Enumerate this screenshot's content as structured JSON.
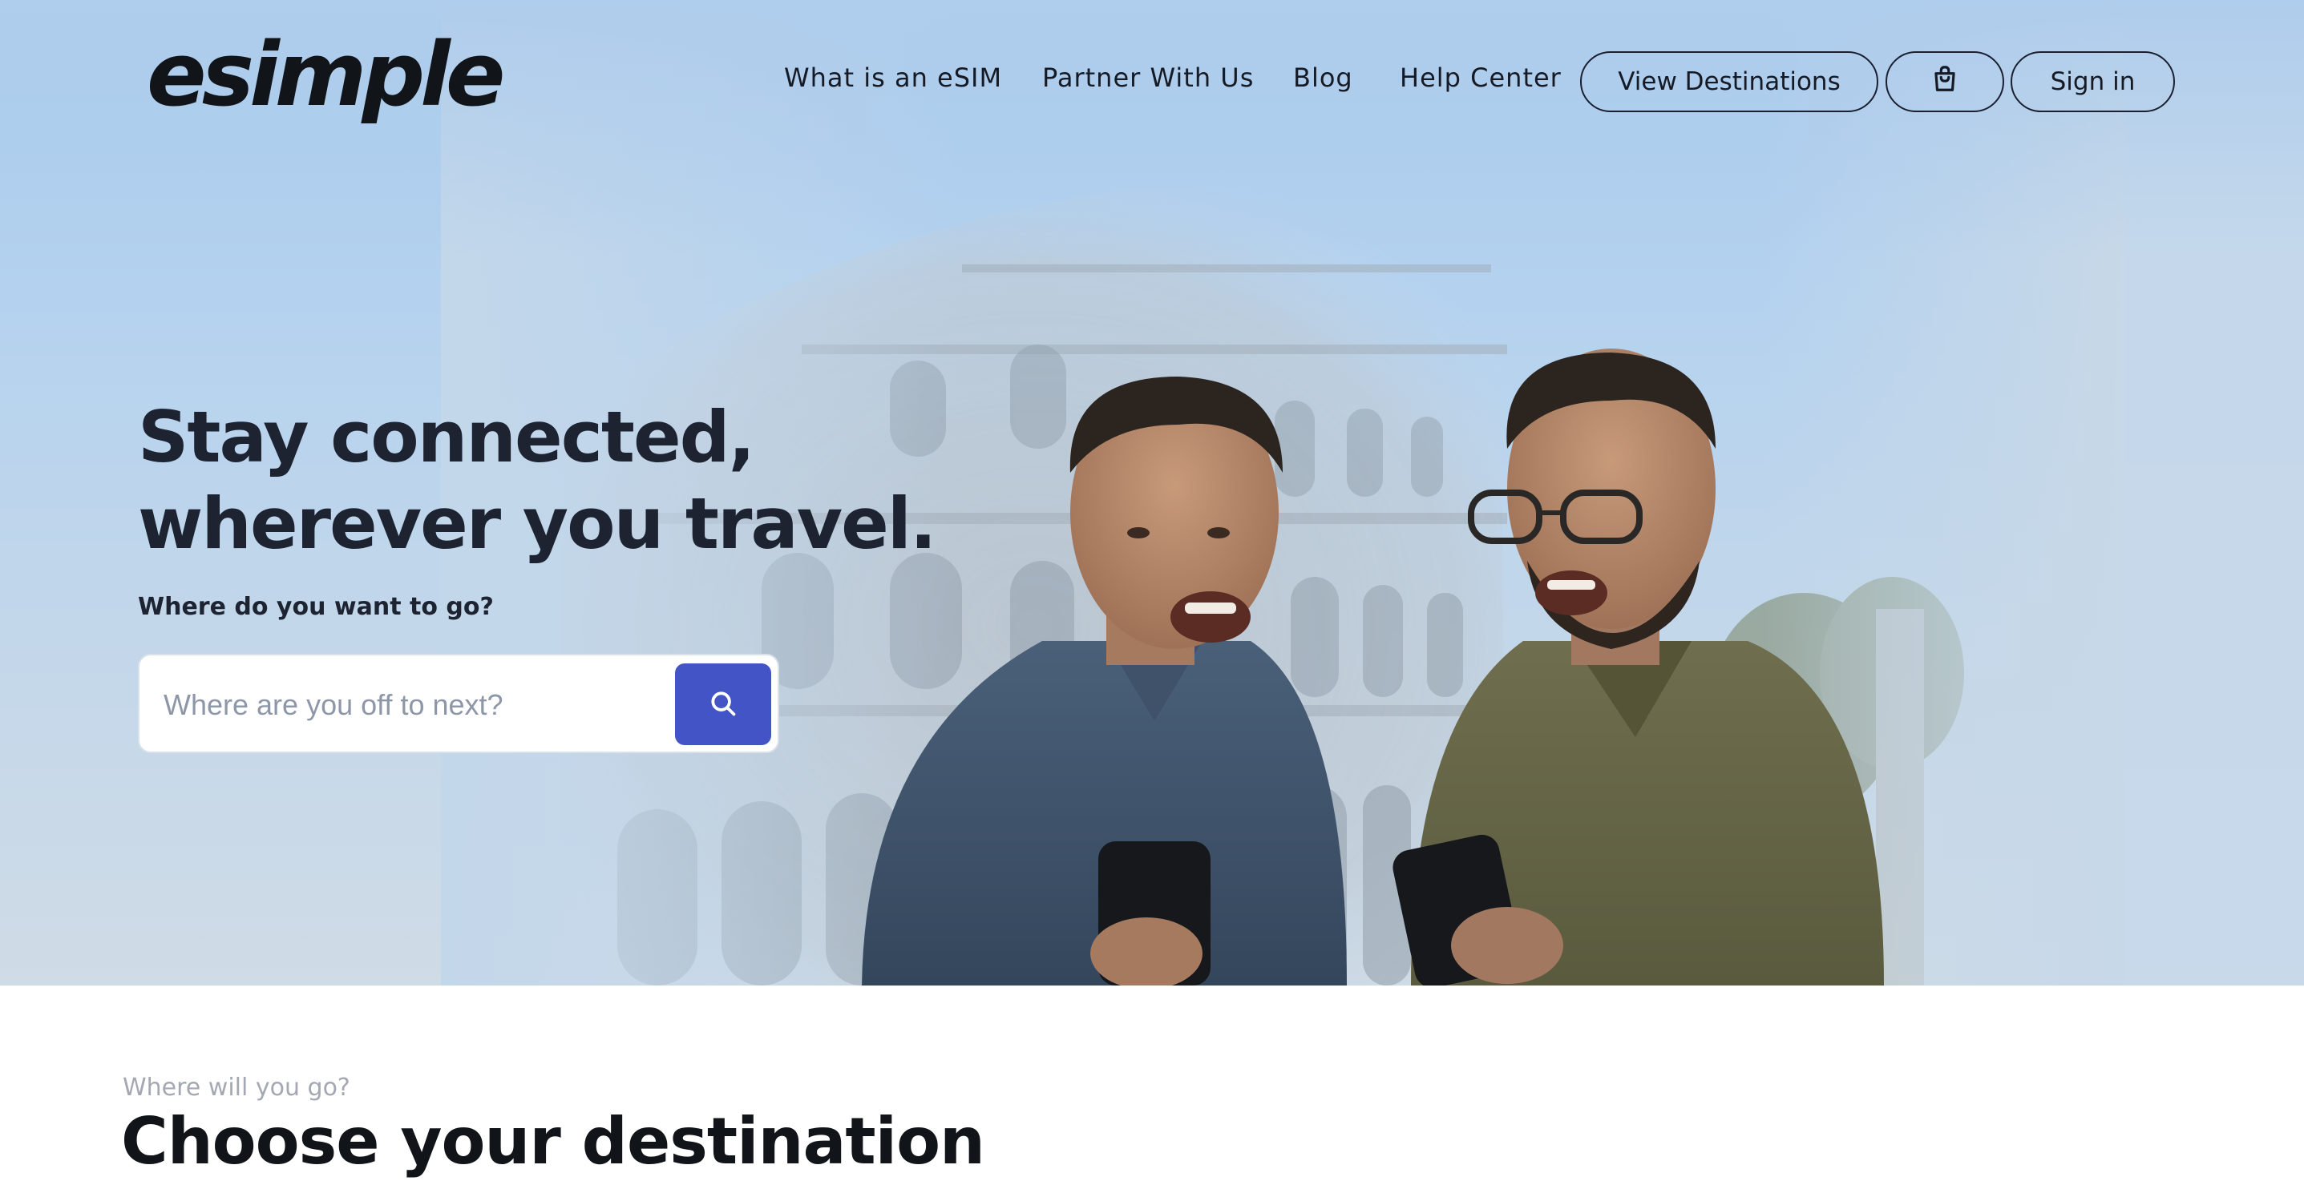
{
  "brand": {
    "logo_text": "esimple"
  },
  "nav": {
    "links": [
      {
        "label": "What is an eSIM"
      },
      {
        "label": "Partner With Us"
      },
      {
        "label": "Blog"
      },
      {
        "label": "Help Center"
      }
    ],
    "view_destinations_label": "View Destinations",
    "cart_icon": "shopping-bag-icon",
    "sign_in_label": "Sign in"
  },
  "hero": {
    "title": "Stay connected, wherever you travel.",
    "subtitle": "Where do you want to go?",
    "search": {
      "placeholder": "Where are you off to next?",
      "value": "",
      "button_icon": "search-icon"
    },
    "image": "two-men-laughing-with-phones-in-front-of-colosseum"
  },
  "destinations": {
    "eyebrow": "Where will you go?",
    "title": "Choose your destination"
  },
  "colors": {
    "hero_sky": "#a9cbee",
    "text_dark": "#1d2331",
    "search_button": "#4254c6",
    "eyebrow_gray": "#a3a8b3"
  }
}
